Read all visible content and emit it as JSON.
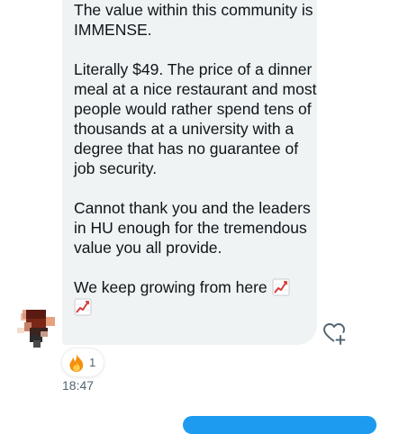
{
  "message": {
    "paragraphs": [
      "The value within this community is IMMENSE.",
      "Literally $49. The price of a dinner meal at a nice restaurant and most people would rather spend tens of thousands at a university with a degree that has no guarantee of job security.",
      "Cannot thank you and the leaders in HU enough for the tremendous value you all provide."
    ],
    "last_line": "We keep growing from here",
    "emoji": "chart-increasing"
  },
  "reaction": {
    "emoji": "fire",
    "count": "1"
  },
  "timestamp": "18:47",
  "colors": {
    "bubble_bg": "#eff3f4",
    "accent_blue": "#1d9bf0",
    "muted_text": "#536471"
  }
}
